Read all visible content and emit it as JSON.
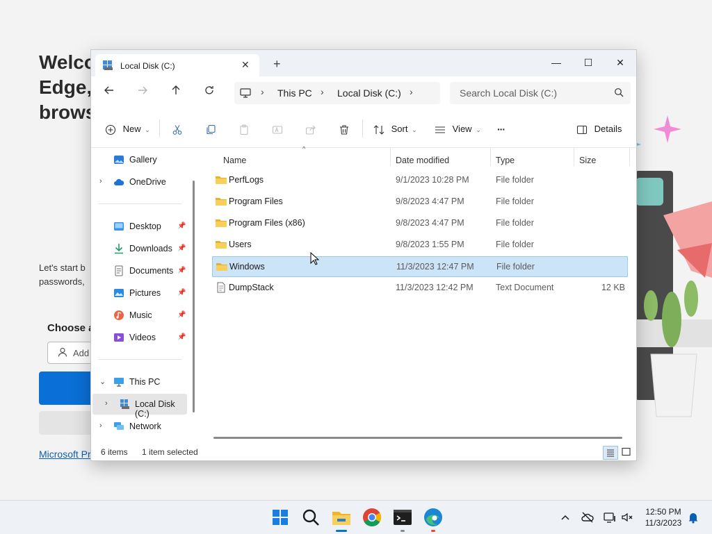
{
  "background": {
    "title_lines": [
      "Welco",
      "Edge,",
      "brows"
    ],
    "text_lines": [
      "Let's start b",
      "passwords,"
    ],
    "choose_label": "Choose a",
    "add_button": "Add",
    "link_text": "Microsoft Pr"
  },
  "window": {
    "tab_title": "Local Disk (C:)",
    "tab_close": "✕",
    "new_tab": "+",
    "controls": {
      "minimize": "—",
      "maximize": "☐",
      "close": "✕"
    },
    "breadcrumbs": [
      "This PC",
      "Local Disk (C:)"
    ],
    "search_placeholder": "Search Local Disk (C:)",
    "toolbar": {
      "new": "New",
      "sort": "Sort",
      "view": "View",
      "more": "···",
      "details": "Details"
    },
    "nav": {
      "gallery": "Gallery",
      "onedrive": "OneDrive",
      "quick_access": [
        {
          "label": "Desktop",
          "icon": "desktop-icon"
        },
        {
          "label": "Downloads",
          "icon": "downloads-icon"
        },
        {
          "label": "Documents",
          "icon": "documents-icon"
        },
        {
          "label": "Pictures",
          "icon": "pictures-icon"
        },
        {
          "label": "Music",
          "icon": "music-icon"
        },
        {
          "label": "Videos",
          "icon": "videos-icon"
        }
      ],
      "this_pc": "This PC",
      "local_disk": "Local Disk (C:)",
      "network": "Network"
    },
    "columns": {
      "name": "Name",
      "date": "Date modified",
      "type": "Type",
      "size": "Size"
    },
    "files": [
      {
        "name": "PerfLogs",
        "date": "9/1/2023 10:28 PM",
        "type": "File folder",
        "size": "",
        "kind": "folder",
        "selected": false
      },
      {
        "name": "Program Files",
        "date": "9/8/2023 4:47 PM",
        "type": "File folder",
        "size": "",
        "kind": "folder",
        "selected": false
      },
      {
        "name": "Program Files (x86)",
        "date": "9/8/2023 4:47 PM",
        "type": "File folder",
        "size": "",
        "kind": "folder",
        "selected": false
      },
      {
        "name": "Users",
        "date": "9/8/2023 1:55 PM",
        "type": "File folder",
        "size": "",
        "kind": "folder",
        "selected": false
      },
      {
        "name": "Windows",
        "date": "11/3/2023 12:47 PM",
        "type": "File folder",
        "size": "",
        "kind": "folder",
        "selected": true
      },
      {
        "name": "DumpStack",
        "date": "11/3/2023 12:42 PM",
        "type": "Text Document",
        "size": "12 KB",
        "kind": "text",
        "selected": false
      }
    ],
    "status": {
      "count": "6 items",
      "selected": "1 item selected"
    }
  },
  "taskbar": {
    "apps": [
      "windows-start-icon",
      "search-icon",
      "file-explorer-icon",
      "chrome-icon",
      "terminal-icon",
      "edge-icon"
    ],
    "time": "12:50 PM",
    "date": "11/3/2023"
  },
  "colors": {
    "accent": "#0a6fd6",
    "selection": "#cce4f7",
    "folder": "#f5c542"
  }
}
